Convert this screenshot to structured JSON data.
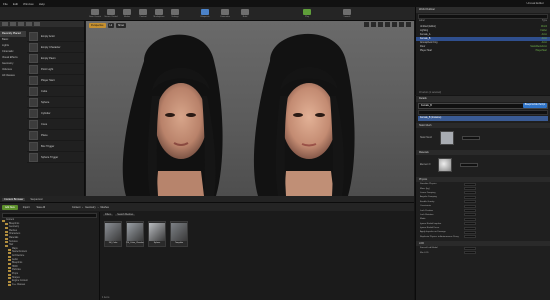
{
  "app": {
    "title": "Unreal Editor"
  },
  "menubar": {
    "items": [
      "File",
      "Edit",
      "Window",
      "Help"
    ]
  },
  "toolbar": {
    "buttons": [
      {
        "label": "Save Current",
        "color": "#7a7a7a"
      },
      {
        "label": "Source Control",
        "color": "#6e6e6e"
      },
      {
        "label": "Modes",
        "color": "#8c8c8c"
      },
      {
        "label": "Content",
        "color": "#6e6e6e"
      },
      {
        "label": "Marketplace",
        "color": "#6e6e6e"
      },
      {
        "label": "Settings",
        "color": "#6e6e6e"
      },
      {
        "label": "Blueprints",
        "color": "#4b82c8"
      },
      {
        "label": "Cinematics",
        "color": "#6e6e6e"
      },
      {
        "label": "Build",
        "color": "#6e6e6e"
      },
      {
        "label": "Play",
        "color": "#6e6e6e"
      },
      {
        "label": "Launch",
        "color": "#6e6e6e"
      }
    ]
  },
  "modes": {
    "categories": [
      "Recently Placed",
      "Basic",
      "Lights",
      "Cinematic",
      "Visual Effects",
      "Geometry",
      "Volumes",
      "All Classes"
    ],
    "selected_category": 0,
    "items": [
      "Empty Actor",
      "Empty Character",
      "Empty Pawn",
      "Point Light",
      "Player Start",
      "Cube",
      "Sphere",
      "Cylinder",
      "Cone",
      "Plane",
      "Box Trigger",
      "Sphere Trigger"
    ]
  },
  "viewport": {
    "left_chips": [
      "Perspective",
      "Lit",
      "Show"
    ],
    "highlight_chip": 0
  },
  "world": {
    "tabs": [
      "Content Browser",
      "Sequencer"
    ],
    "active_tab": 0
  },
  "content_browser": {
    "add_label": "Add New",
    "import_label": "Import",
    "save_all_label": "Save All",
    "path": [
      "Content",
      "Geometry",
      "Meshes"
    ],
    "filters": [
      "Filters",
      "Search Meshes"
    ],
    "folders": [
      "Content",
      "Blueprints",
      "Geometry",
      "Meshes",
      "Characters",
      "Materials",
      "Textures",
      "Hair",
      "Maps",
      "StarterContent",
      "Architecture",
      "Audio",
      "Blueprints",
      "HDRI",
      "Particles",
      "Props",
      "Shapes",
      "Engine Content",
      "C++ Classes"
    ],
    "assets": [
      {
        "label": "1M_Cube",
        "color": "#8b8f95"
      },
      {
        "label": "1M_Cube_Chamfer",
        "color": "#9aa0a6"
      },
      {
        "label": "Sphere",
        "color": "#b9bcc0"
      },
      {
        "label": "Template",
        "color": "#7d8186"
      }
    ],
    "footer": "4 items"
  },
  "outliner": {
    "title": "World Outliner",
    "columns": [
      "Label",
      "Type"
    ],
    "rows": [
      {
        "label": "Untitled (Editor)",
        "type": "World"
      },
      {
        "label": "Lighting",
        "type": "Folder"
      },
      {
        "label": "Female_A",
        "type": "Actor"
      },
      {
        "label": "Female_B",
        "type": "Actor"
      },
      {
        "label": "Atmospheric Fog",
        "type": "Actor"
      },
      {
        "label": "Floor",
        "type": "StaticMeshActor"
      },
      {
        "label": "Player Start",
        "type": "PlayerStart"
      }
    ],
    "selected_row": 3,
    "footer": "18 actors (1 selected)"
  },
  "details": {
    "title": "Details",
    "name_value": "Female_B",
    "blueprint_btn": "Blueprint/Add Script",
    "selected_component": "Female_B (Instance)",
    "sections": [
      {
        "title": "Static Mesh",
        "thumb": "Static Mesh",
        "color": "#a8acb2"
      },
      {
        "title": "Materials",
        "thumb": "Element 0",
        "color": "#c4c4c4"
      }
    ],
    "physics_title": "Physics",
    "physics_props": [
      "Simulate Physics",
      "Mass (kg)",
      "Linear Damping",
      "Angular Damping",
      "Enable Gravity",
      "Constraints",
      "Lock Position",
      "Lock Rotation",
      "Mode",
      "Ignore Radial Impulse",
      "Ignore Radial Force",
      "Apply Impulse on Damage",
      "Replicate Physics to Autonomous Proxy"
    ],
    "lod_title": "LOD",
    "lod_props": [
      "Forced Lod Model",
      "Min LOD"
    ]
  }
}
